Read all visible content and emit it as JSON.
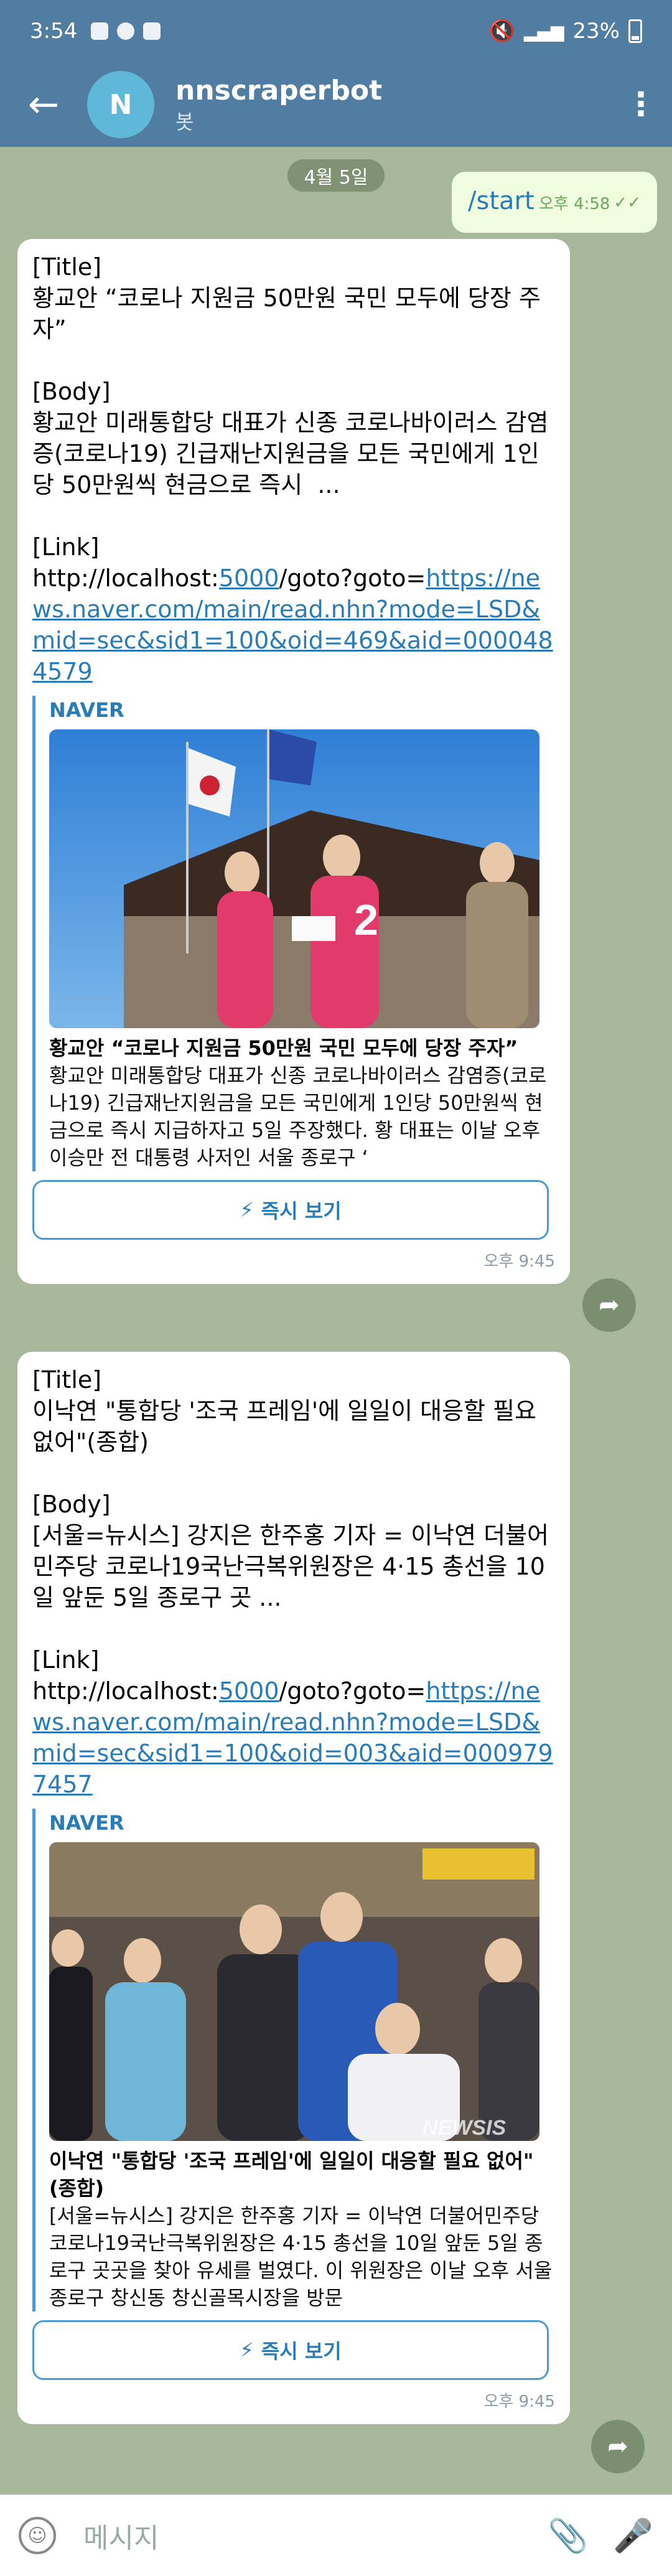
{
  "status_bar": {
    "time": "3:54",
    "battery": "23%"
  },
  "app_bar": {
    "avatar_letter": "N",
    "title": "nnscraperbot",
    "subtitle": "봇"
  },
  "date_chip": "4월 5일",
  "outgoing": {
    "text": "/start",
    "time": "오후 4:58"
  },
  "messages": [
    {
      "title_tag": "[Title]",
      "title": "황교안 “코로나 지원금 50만원 국민 모두에 당장 주자”",
      "body_tag": "[Body]",
      "body": "황교안 미래통합당 대표가 신종 코로나바이러스 감염증(코로나19) 긴급재난지원금을 모든 국민에게 1인당 50만원씩 현금으로 즉시  ...",
      "link_tag": "[Link]",
      "link_prefix": "http://localhost:",
      "link_port": "5000",
      "link_path": "/goto?goto=",
      "link_url": "https://news.naver.com/main/read.nhn?mode=LSD&mid=sec&sid1=100&oid=469&aid=0000484579",
      "preview_site": "NAVER",
      "preview_title": "황교안 “코로나 지원금 50만원 국민 모두에 당장 주자”",
      "preview_desc": "황교안 미래통합당 대표가 신종 코로나바이러스 감염증(코로나19) 긴급재난지원금을 모든 국민에게 1인당 50만원씩 현금으로 즉시 지급하자고 5일 주장했다. 황 대표는 이날 오후 이승만 전 대통령 사저인 서울 종로구 ‘",
      "instant_view": "즉시 보기",
      "time": "오후 9:45"
    },
    {
      "title_tag": "[Title]",
      "title": "이낙연 \"통합당 '조국 프레임'에 일일이 대응할 필요 없어\"(종합)",
      "body_tag": "[Body]",
      "body": "[서울=뉴시스] 강지은 한주홍 기자 = 이낙연 더불어민주당 코로나19국난극복위원장은 4·15 총선을 10일 앞둔 5일 종로구 곳 ...",
      "link_tag": "[Link]",
      "link_prefix": "http://localhost:",
      "link_port": "5000",
      "link_path": "/goto?goto=",
      "link_url": "https://news.naver.com/main/read.nhn?mode=LSD&mid=sec&sid1=100&oid=003&aid=0009797457",
      "preview_site": "NAVER",
      "preview_title": "이낙연 \"통합당 '조국 프레임'에 일일이 대응할 필요 없어\"(종합)",
      "preview_desc": "[서울=뉴시스] 강지은 한주홍 기자 = 이낙연 더불어민주당 코로나19국난극복위원장은 4·15 총선을 10일 앞둔 5일 종로구 곳곳을 찾아 유세를 벌였다. 이 위원장은 이날 오후 서울 종로구 창신동 창신골목시장을 방문",
      "photo_watermark": "NEWSIS",
      "instant_view": "즉시 보기",
      "time": "오후 9:45"
    }
  ],
  "input": {
    "placeholder": "메시지"
  }
}
